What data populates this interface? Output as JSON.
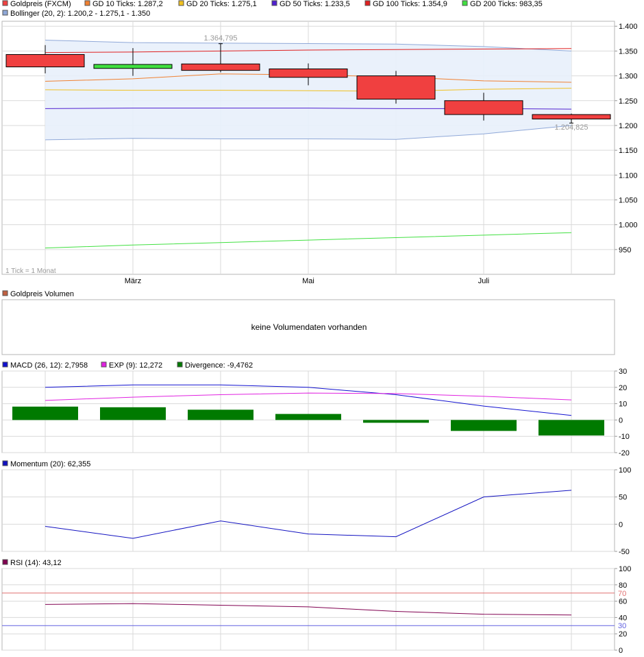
{
  "colors": {
    "grid": "#d9d9d9",
    "frame": "#b5b5b5",
    "text": "#000000",
    "muted": "#999999",
    "candle_down": "#f04040",
    "candle_up": "#40e040",
    "bollinger_fill": "#e8effb",
    "bollinger_line": "#8fa8d8",
    "gd10": "#f08030",
    "gd20": "#f0c020",
    "gd50": "#5020d0",
    "gd100": "#e02020",
    "gd200": "#40e040",
    "macd": "#1010d0",
    "exp": "#e020e0",
    "divergence": "#007a00",
    "momentum": "#1010c0",
    "rsi": "#800050",
    "rsi70": "#e07070",
    "rsi30": "#6060e0",
    "volume_legend": "#c06040"
  },
  "price_panel": {
    "legend": [
      {
        "label": "Goldpreis (FXCM)",
        "color": "#f04040"
      },
      {
        "label": "GD 10 Ticks: 1.287,2",
        "color": "#f08030"
      },
      {
        "label": "GD 20 Ticks: 1.275,1",
        "color": "#f0c020"
      },
      {
        "label": "GD 50 Ticks: 1.233,5",
        "color": "#5020d0"
      },
      {
        "label": "GD 100 Ticks: 1.354,9",
        "color": "#e02020"
      },
      {
        "label": "GD 200 Ticks: 983,35",
        "color": "#40e040"
      }
    ],
    "legend2": {
      "label": "Bollinger (20, 2): 1.200,2 - 1.275,1 - 1.350",
      "color": "#8fa8d8"
    },
    "tick_note": "1 Tick = 1 Monat",
    "high_label": "1.364,795",
    "low_label": "1.204,825",
    "x_labels": [
      "März",
      "Mai",
      "Juli"
    ]
  },
  "volume_panel": {
    "legend": {
      "label": "Goldpreis Volumen",
      "color": "#c06040"
    },
    "message": "keine Volumendaten vorhanden"
  },
  "macd_panel": {
    "legend": [
      {
        "label": "MACD (26, 12): 2,7958",
        "color": "#1010d0"
      },
      {
        "label": "EXP (9): 12,272",
        "color": "#e020e0"
      },
      {
        "label": "Divergence: -9,4762",
        "color": "#007a00"
      }
    ]
  },
  "momentum_panel": {
    "legend": {
      "label": "Momentum (20): 62,355",
      "color": "#1010c0"
    }
  },
  "rsi_panel": {
    "legend": {
      "label": "RSI (14): 43,12",
      "color": "#800050"
    },
    "level_70": "70",
    "level_30": "30"
  },
  "chart_data": [
    {
      "type": "candlestick",
      "title": "Goldpreis (FXCM)",
      "ylim": [
        900,
        1410
      ],
      "y_ticks": [
        950,
        1000,
        1050,
        1100,
        1150,
        1200,
        1250,
        1300,
        1350,
        1400
      ],
      "y_tick_labels": [
        "950",
        "1.000",
        "1.050",
        "1.100",
        "1.150",
        "1.200",
        "1.250",
        "1.300",
        "1.350",
        "1.400"
      ],
      "x_labels": [
        "März",
        "Mai",
        "Juli"
      ],
      "candles": [
        {
          "open": 1343,
          "close": 1318,
          "high": 1362,
          "low": 1305
        },
        {
          "open": 1315,
          "close": 1323,
          "high": 1356,
          "low": 1300
        },
        {
          "open": 1324,
          "close": 1311,
          "high": 1364.795,
          "low": 1307
        },
        {
          "open": 1314,
          "close": 1297,
          "high": 1325,
          "low": 1281
        },
        {
          "open": 1300,
          "close": 1253,
          "high": 1310,
          "low": 1244
        },
        {
          "open": 1250,
          "close": 1222,
          "high": 1266,
          "low": 1210
        },
        {
          "open": 1222,
          "close": 1213,
          "high": 1224,
          "low": 1204.825
        }
      ],
      "series": [
        {
          "name": "GD 10 Ticks",
          "values": [
            1289,
            1294,
            1304,
            1302,
            1298,
            1290,
            1287
          ]
        },
        {
          "name": "GD 20 Ticks",
          "values": [
            1272,
            1271,
            1271,
            1270,
            1269,
            1273,
            1275
          ]
        },
        {
          "name": "GD 50 Ticks",
          "values": [
            1234,
            1235,
            1235,
            1235,
            1234,
            1234,
            1233
          ]
        },
        {
          "name": "GD 100 Ticks",
          "values": [
            1347,
            1348,
            1350,
            1352,
            1353,
            1354,
            1355
          ]
        },
        {
          "name": "GD 200 Ticks",
          "values": [
            953,
            959,
            964,
            969,
            974,
            979,
            984
          ]
        },
        {
          "name": "Bollinger upper",
          "values": [
            1372,
            1367,
            1366,
            1365,
            1364,
            1359,
            1350
          ]
        },
        {
          "name": "Bollinger lower",
          "values": [
            1171,
            1174,
            1173,
            1173,
            1172,
            1183,
            1200
          ]
        }
      ]
    },
    {
      "type": "bar+line",
      "title": "MACD",
      "ylim": [
        -20,
        30
      ],
      "y_ticks": [
        -20,
        -10,
        0,
        10,
        20,
        30
      ],
      "series": [
        {
          "name": "MACD (26, 12)",
          "values": [
            20,
            21.5,
            21.5,
            20,
            15.5,
            8.5,
            2.8
          ]
        },
        {
          "name": "EXP (9)",
          "values": [
            12,
            14,
            15.5,
            16.5,
            16.2,
            14.5,
            12.3
          ]
        },
        {
          "name": "Divergence",
          "values": [
            8.2,
            7.8,
            6.3,
            3.7,
            -1.7,
            -6.7,
            -9.5
          ]
        }
      ]
    },
    {
      "type": "line",
      "title": "Momentum (20)",
      "ylim": [
        -50,
        100
      ],
      "y_ticks": [
        -50,
        0,
        50,
        100
      ],
      "series": [
        {
          "name": "Momentum (20)",
          "values": [
            -4,
            -26,
            6,
            -18,
            -23,
            50,
            62.4
          ]
        }
      ]
    },
    {
      "type": "line",
      "title": "RSI (14)",
      "ylim": [
        0,
        100
      ],
      "y_ticks": [
        0,
        20,
        40,
        60,
        80,
        100
      ],
      "series": [
        {
          "name": "RSI (14)",
          "values": [
            56,
            57,
            55,
            53,
            47.5,
            44,
            43.1
          ]
        }
      ]
    }
  ]
}
